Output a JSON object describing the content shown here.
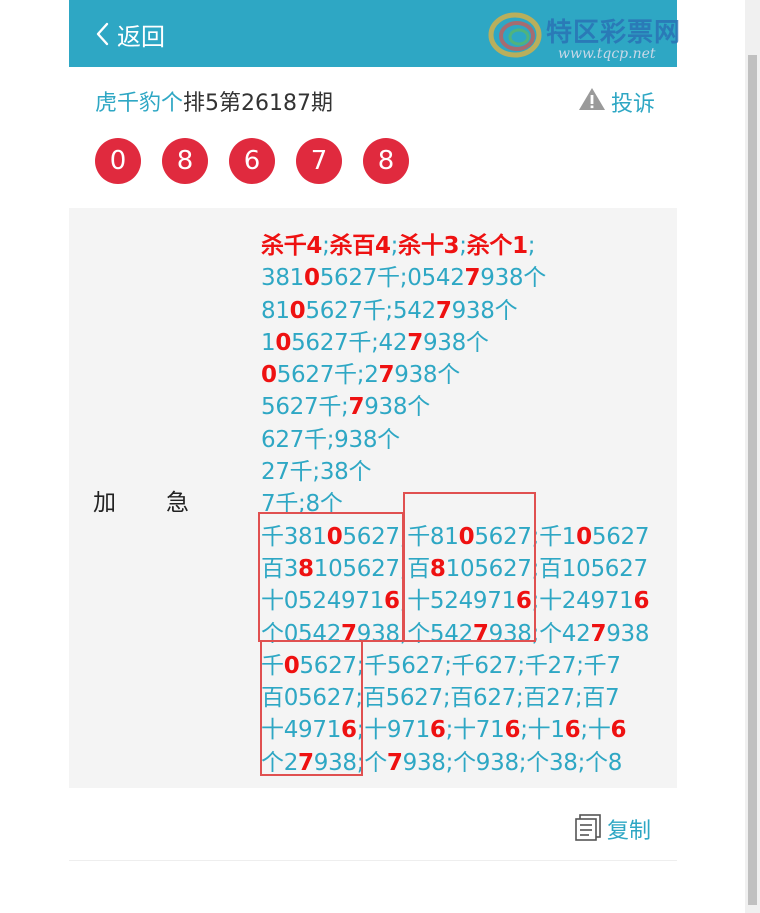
{
  "header": {
    "back_label": "返回"
  },
  "logo": {
    "name": "特区彩票网",
    "url": "www.tqcp.net"
  },
  "title": {
    "link": "虎千豹个",
    "rest": "排5第26187期"
  },
  "complain_label": "投诉",
  "balls": [
    "0",
    "8",
    "6",
    "7",
    "8"
  ],
  "content": {
    "label_a": "加",
    "label_b": "急",
    "lines": [
      [
        [
          "杀千4",
          "h"
        ],
        [
          ";",
          "s"
        ],
        [
          "杀百4",
          "h"
        ],
        [
          ";",
          "s"
        ],
        [
          "杀十3",
          "h"
        ],
        [
          ";",
          "s"
        ],
        [
          "杀个1",
          "h"
        ],
        [
          ";",
          "s"
        ]
      ],
      [
        [
          "381",
          ""
        ],
        [
          "0",
          "h"
        ],
        [
          "5627千;0542",
          ""
        ],
        [
          "7",
          "h"
        ],
        [
          "938个",
          ""
        ]
      ],
      [
        [
          "81",
          ""
        ],
        [
          "0",
          "h"
        ],
        [
          "5627千;542",
          ""
        ],
        [
          "7",
          "h"
        ],
        [
          "938个",
          ""
        ]
      ],
      [
        [
          "1",
          ""
        ],
        [
          "0",
          "h"
        ],
        [
          "5627千;42",
          ""
        ],
        [
          "7",
          "h"
        ],
        [
          "938个",
          ""
        ]
      ],
      [
        [
          "0",
          "h"
        ],
        [
          "5627千;2",
          ""
        ],
        [
          "7",
          "h"
        ],
        [
          "938个",
          ""
        ]
      ],
      [
        [
          "5627千;",
          ""
        ],
        [
          "7",
          "h"
        ],
        [
          "938个",
          ""
        ]
      ],
      [
        [
          "627千;938个",
          ""
        ]
      ],
      [
        [
          "27千;38个",
          ""
        ]
      ],
      [
        [
          "7千;8个",
          ""
        ]
      ],
      [
        [
          "千381",
          ""
        ],
        [
          "0",
          "h"
        ],
        [
          "5627",
          ""
        ],
        [
          ";",
          "s"
        ],
        [
          "千81",
          ""
        ],
        [
          "0",
          "h"
        ],
        [
          "5627",
          ""
        ],
        [
          ";",
          "s"
        ],
        [
          "千1",
          ""
        ],
        [
          "0",
          "h"
        ],
        [
          "5627",
          ""
        ]
      ],
      [
        [
          "百3",
          ""
        ],
        [
          "8",
          "h"
        ],
        [
          "105627",
          ""
        ],
        [
          ";",
          "s"
        ],
        [
          "百",
          ""
        ],
        [
          "8",
          "h"
        ],
        [
          "105627",
          ""
        ],
        [
          ";",
          "s"
        ],
        [
          "百105627",
          ""
        ]
      ],
      [
        [
          "十0524971",
          ""
        ],
        [
          "6",
          "h"
        ],
        [
          ";",
          "s"
        ],
        [
          "十524971",
          ""
        ],
        [
          "6",
          "h"
        ],
        [
          ";",
          "s"
        ],
        [
          "十24971",
          ""
        ],
        [
          "6",
          "h"
        ]
      ],
      [
        [
          "个0542",
          ""
        ],
        [
          "7",
          "h"
        ],
        [
          "938",
          ""
        ],
        [
          ";",
          "s"
        ],
        [
          "个542",
          ""
        ],
        [
          "7",
          "h"
        ],
        [
          "938",
          ""
        ],
        [
          ";",
          "s"
        ],
        [
          "个42",
          ""
        ],
        [
          "7",
          "h"
        ],
        [
          "938",
          ""
        ]
      ],
      [
        [
          "千",
          ""
        ],
        [
          "0",
          "h"
        ],
        [
          "5627;千5627;千627;千27;千7",
          ""
        ]
      ],
      [
        [
          "百05627;百5627;百627;百27;百7",
          ""
        ]
      ],
      [
        [
          "十4971",
          ""
        ],
        [
          "6",
          "h"
        ],
        [
          ";十971",
          ""
        ],
        [
          "6",
          "h"
        ],
        [
          ";十71",
          ""
        ],
        [
          "6",
          "h"
        ],
        [
          ";十1",
          ""
        ],
        [
          "6",
          "h"
        ],
        [
          ";十",
          ""
        ],
        [
          "6",
          "h"
        ]
      ],
      [
        [
          "个2",
          ""
        ],
        [
          "7",
          "h"
        ],
        [
          "938;个",
          ""
        ],
        [
          "7",
          "h"
        ],
        [
          "938;个938;个38;个8",
          ""
        ]
      ]
    ]
  },
  "copy_label": "复制",
  "colors": {
    "accent": "#2ea7c4",
    "ball": "#e02a3e",
    "highlight": "#ee1111",
    "frame": "#e05050"
  },
  "icons": {
    "back": "chevron-left-icon",
    "complain": "warning-icon",
    "copy": "copy-document-icon"
  }
}
